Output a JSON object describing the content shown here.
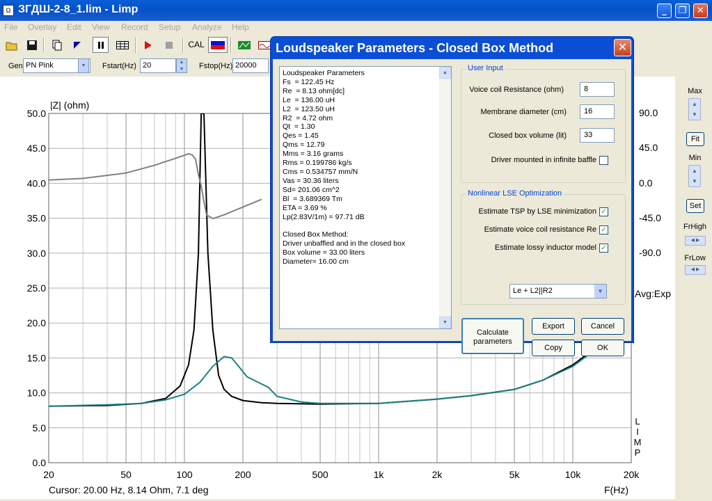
{
  "window": {
    "title": "ЗГДШ-2-8_1.lim - Limp",
    "app_icon": "Ω"
  },
  "menu": [
    "File",
    "Overlay",
    "Edit",
    "View",
    "Record",
    "Setup",
    "Analyze",
    "Help"
  ],
  "toolbar": {
    "cal_label": "CAL"
  },
  "gen": {
    "label": "Gen",
    "value": "PN Pink",
    "fstart_label": "Fstart(Hz)",
    "fstart_value": "20",
    "fstop_label": "Fstop(Hz)",
    "fstop_value": "20000"
  },
  "plot": {
    "y_title": "|Z| (ohm)",
    "x_title": "F(Hz)",
    "y_ticks": [
      "50.0",
      "45.0",
      "40.0",
      "35.0",
      "30.0",
      "25.0",
      "20.0",
      "15.0",
      "10.0",
      "5.0",
      "0.0"
    ],
    "y2_ticks": [
      "90.0",
      "45.0",
      "0.0",
      "-45.0",
      "-90.0"
    ],
    "x_ticks": [
      "20",
      "50",
      "100",
      "200",
      "500",
      "1k",
      "2k",
      "5k",
      "10k",
      "20k"
    ],
    "avg_label": "Avg:Exp",
    "side_label": "LIMP",
    "cursor": "Cursor: 20.00 Hz, 8.14 Ohm, 7.1 deg"
  },
  "right_panel": {
    "max": "Max",
    "fit": "Fit",
    "min": "Min",
    "set": "Set",
    "frhigh": "FrHigh",
    "frlow": "FrLow"
  },
  "dialog": {
    "title": "Loudspeaker Parameters - Closed Box Method",
    "results_text": "Loudspeaker Parameters\nFs  = 122.45 Hz\nRe  = 8.13 ohm[dc]\nLe  = 136.00 uH\nL2  = 123.50 uH\nR2  = 4.72 ohm\nQt  = 1.30\nQes = 1.45\nQms = 12.79\nMms = 3.16 grams\nRms = 0.199786 kg/s\nCms = 0.534757 mm/N\nVas = 30.36 liters\nSd= 201.06 cm^2\nBl  = 3.689369 Tm\nETA = 3.69 %\nLp(2.83V/1m) = 97.71 dB\n\nClosed Box Method:\nDriver unbaffled and in the closed box\nBox volume = 33.00 liters\nDiameter= 16.00 cm",
    "user_input": {
      "title": "User Input",
      "vc_resistance_label": "Voice coil Resistance (ohm)",
      "vc_resistance_value": "8",
      "membrane_label": "Membrane diameter (cm)",
      "membrane_value": "16",
      "box_volume_label": "Closed box volume (lit)",
      "box_volume_value": "33",
      "infinite_baffle_label": "Driver mounted in infinite baffle"
    },
    "lse": {
      "title": "Nonlinear LSE Optimization",
      "estimate_tsp_label": "Estimate TSP by LSE minimization",
      "estimate_re_label": "Estimate voice coil resistance Re",
      "estimate_lossy_label": "Estimate lossy inductor model",
      "model_value": "Le + L2||R2",
      "check_mark": "✓"
    },
    "buttons": {
      "calculate": "Calculate parameters",
      "export": "Export",
      "cancel": "Cancel",
      "copy": "Copy",
      "ok": "OK"
    }
  },
  "chart_data": {
    "type": "line",
    "x_scale": "log",
    "xlim": [
      20,
      20000
    ],
    "ylim": [
      0,
      50
    ],
    "y2lim": [
      -90,
      90
    ],
    "grid": true,
    "series": [
      {
        "color": "#000000",
        "axis": "left",
        "x": [
          20,
          40,
          60,
          80,
          95,
          105,
          112,
          118,
          122,
          126,
          132,
          140,
          150,
          160,
          175,
          200,
          250,
          300,
          500,
          1000,
          2000,
          3000,
          5000,
          7000,
          10000,
          14000
        ],
        "y": [
          8.1,
          8.2,
          8.5,
          9.2,
          11,
          14,
          19,
          30,
          50,
          50,
          30,
          19,
          12.5,
          10.5,
          9.5,
          8.9,
          8.6,
          8.5,
          8.4,
          8.5,
          9.1,
          9.6,
          10.5,
          11.8,
          14,
          17
        ]
      },
      {
        "color": "#1a8080",
        "axis": "left",
        "x": [
          20,
          40,
          60,
          80,
          100,
          120,
          140,
          160,
          175,
          190,
          210,
          240,
          270,
          300,
          400,
          500,
          1000,
          2000,
          3000,
          5000,
          7000,
          10000,
          14000
        ],
        "y": [
          8.1,
          8.3,
          8.5,
          9,
          9.8,
          11.5,
          13.8,
          15.2,
          15,
          13.8,
          12.3,
          11.5,
          10.8,
          9.5,
          8.7,
          8.5,
          8.5,
          9.1,
          9.6,
          10.5,
          11.8,
          13.8,
          16.8
        ]
      },
      {
        "color": "#808080",
        "axis": "right",
        "x": [
          20,
          30,
          50,
          70,
          90,
          100,
          105,
          110,
          114,
          118,
          122,
          126,
          130,
          140,
          160,
          200,
          250
        ],
        "y": [
          3,
          5,
          12,
          22,
          31,
          35,
          37,
          35,
          30,
          10,
          -5,
          -25,
          -42,
          -47,
          -42,
          -32,
          -22
        ]
      }
    ]
  }
}
